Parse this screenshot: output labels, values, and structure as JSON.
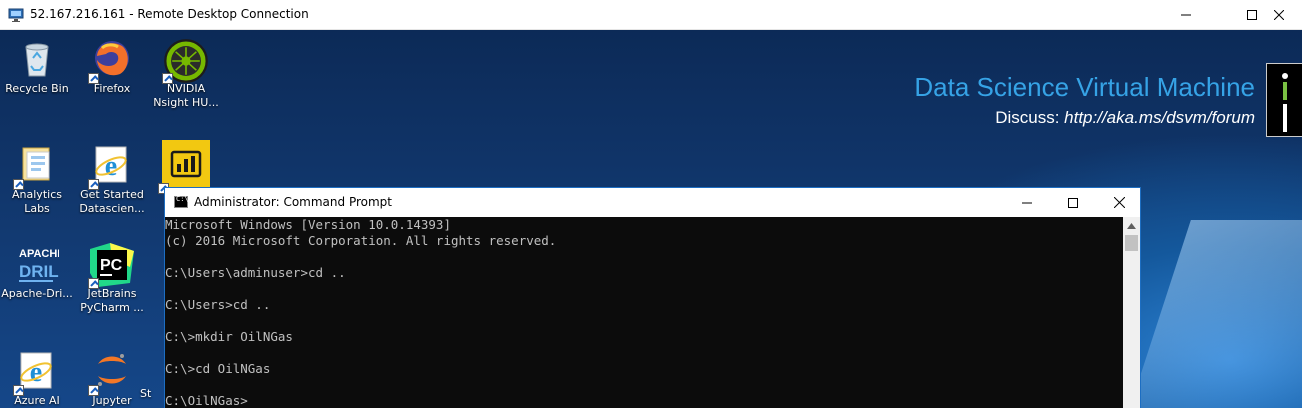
{
  "rdp": {
    "title": "52.167.216.161 - Remote Desktop Connection",
    "icon": "remote-desktop-icon",
    "controls": [
      "minimize-icon",
      "maximize-icon",
      "close-icon"
    ]
  },
  "wallpaper": {
    "heading": "Data Science Virtual Machine",
    "discuss_label": "Discuss: ",
    "discuss_url": "http://aka.ms/dsvm/forum",
    "heading_color": "#36a3e6"
  },
  "desktop_icons": [
    {
      "label": "Recycle Bin",
      "icon": "recycle-bin-icon"
    },
    {
      "label": "Firefox",
      "icon": "firefox-icon"
    },
    {
      "label": "NVIDIA Nsight HU...",
      "icon": "nvidia-nsight-icon"
    },
    {
      "label": "Analytics Labs",
      "icon": "folder-icon"
    },
    {
      "label": "Get Started Datascien...",
      "icon": "internet-explorer-icon"
    },
    {
      "label": "",
      "icon": "power-bi-icon"
    },
    {
      "label": "Apache-Dri...",
      "icon": "apache-drill-icon"
    },
    {
      "label": "JetBrains PyCharm ...",
      "icon": "pycharm-icon"
    },
    {
      "label": "Azure AI",
      "icon": "internet-explorer-icon"
    },
    {
      "label": "Jupyter",
      "icon": "jupyter-icon"
    },
    {
      "label": "St",
      "icon": "partial-icon"
    }
  ],
  "cmd": {
    "title": "Administrator: Command Prompt",
    "lines": [
      "Microsoft Windows [Version 10.0.14393]",
      "(c) 2016 Microsoft Corporation. All rights reserved.",
      "",
      "C:\\Users\\adminuser>cd ..",
      "",
      "C:\\Users>cd ..",
      "",
      "C:\\>mkdir OilNGas",
      "",
      "C:\\>cd OilNGas",
      "",
      "C:\\OilNGas>"
    ]
  }
}
